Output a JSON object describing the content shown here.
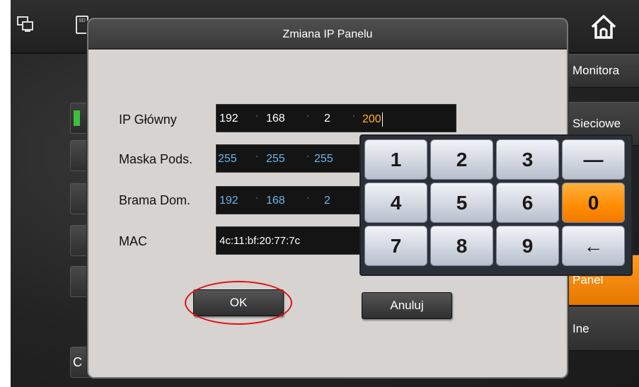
{
  "dialog": {
    "title": "Zmiana IP Panelu",
    "rows": [
      {
        "label": "IP Główny",
        "values": [
          "192",
          "168",
          "2",
          "200"
        ]
      },
      {
        "label": "Maska Pods.",
        "values": [
          "255",
          "255",
          "255"
        ]
      },
      {
        "label": "Brama Dom.",
        "values": [
          "192",
          "168",
          "2"
        ]
      },
      {
        "label": "MAC",
        "value": "4c:11:bf:20:77:7c"
      }
    ],
    "ok_label": "OK",
    "cancel_label": "Anuluj"
  },
  "keypad": {
    "keys": [
      "1",
      "2",
      "3",
      "—",
      "4",
      "5",
      "6",
      "0",
      "7",
      "8",
      "9",
      "←"
    ]
  },
  "background": {
    "side_menu": [
      "Monitora",
      "Sieciowe",
      "Panel",
      "Ine"
    ],
    "left_partial_text": "C",
    "top_icon_sd": "SD"
  },
  "colors": {
    "accent_orange": "#ff8c00",
    "highlight_circle": "#e01010",
    "active_field_text": "#ffb31a",
    "mask_text_blue": "#6cb4e8"
  }
}
